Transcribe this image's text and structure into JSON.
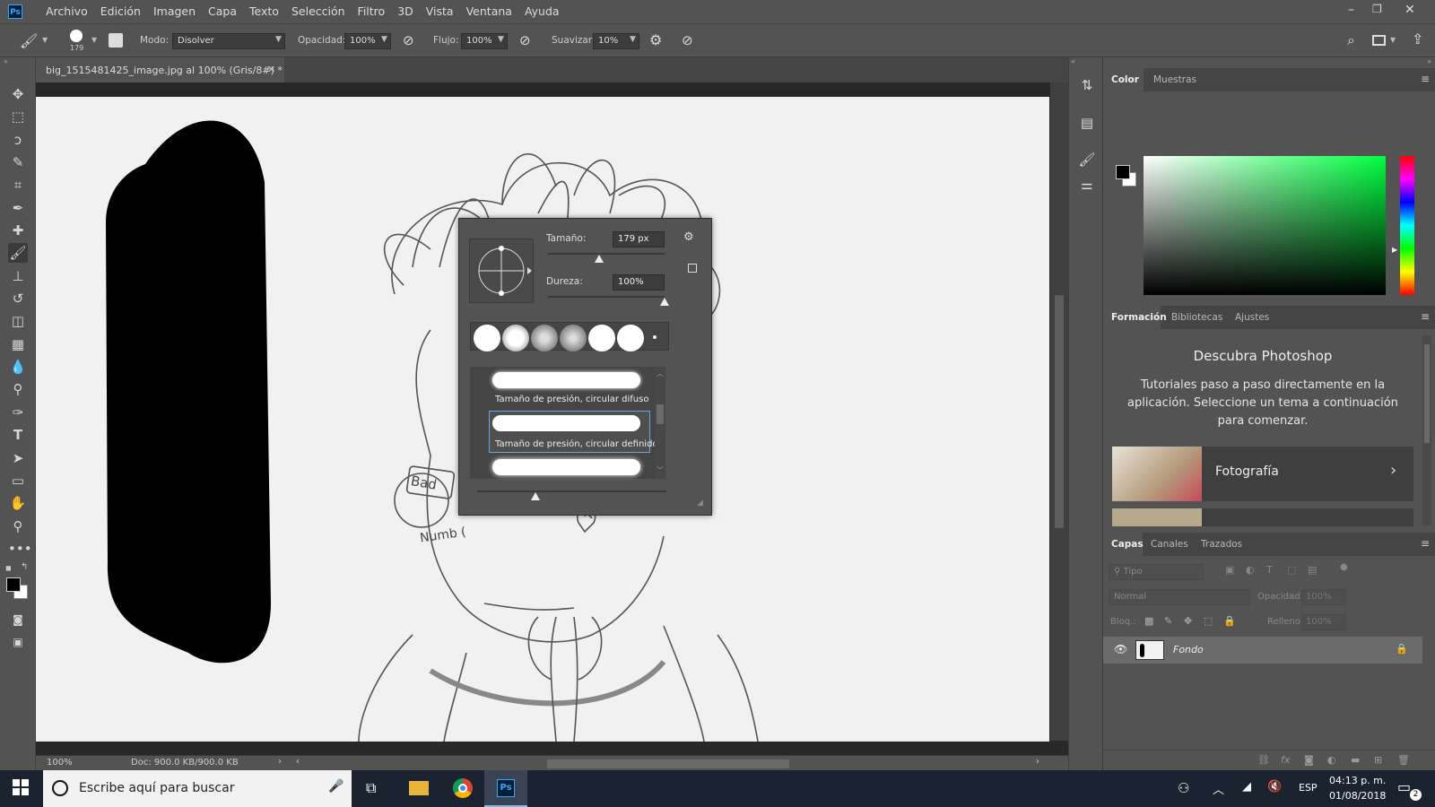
{
  "app": {
    "logo": "Ps"
  },
  "menu": [
    "Archivo",
    "Edición",
    "Imagen",
    "Capa",
    "Texto",
    "Selección",
    "Filtro",
    "3D",
    "Vista",
    "Ventana",
    "Ayuda"
  ],
  "options": {
    "brush_size": "179",
    "mode_label": "Modo:",
    "mode_value": "Disolver",
    "opacity_label": "Opacidad:",
    "opacity_value": "100%",
    "flow_label": "Flujo:",
    "flow_value": "100%",
    "smoothing_label": "Suavizar:",
    "smoothing_value": "10%"
  },
  "document": {
    "tab_title": "big_1515481425_image.jpg al 100% (Gris/8#) *",
    "zoom": "100%",
    "doc_info": "Doc: 900.0 KB/900.0 KB",
    "drawing_text": [
      "Bad",
      "Numb ("
    ]
  },
  "brush_popup": {
    "size_label": "Tamaño:",
    "size_value": "179 px",
    "size_fraction": 0.44,
    "hardness_label": "Dureza:",
    "hardness_value": "100%",
    "hardness_fraction": 1.0,
    "presets": [
      {
        "label": "Tamaño de presión, circular difuso",
        "selected": false
      },
      {
        "label": "Tamaño de presión, circular definido",
        "selected": true
      }
    ]
  },
  "color_panel": {
    "tabs": [
      "Color",
      "Muestras"
    ],
    "foreground": "#000000",
    "background": "#ffffff",
    "hue_color": "#00ff40"
  },
  "learn_panel": {
    "tabs": [
      "Formación",
      "Bibliotecas",
      "Ajustes"
    ],
    "title": "Descubra Photoshop",
    "description": "Tutoriales paso a paso directamente en la aplicación. Seleccione un tema a continuación para comenzar.",
    "card_label": "Fotografía"
  },
  "layers_panel": {
    "tabs": [
      "Capas",
      "Canales",
      "Trazados"
    ],
    "filter_placeholder": "Tipo",
    "blend_mode": "Normal",
    "opacity_label": "Opacidad:",
    "opacity_value": "100%",
    "lock_label": "Bloq.:",
    "fill_label": "Relleno:",
    "fill_value": "100%",
    "layers": [
      {
        "name": "Fondo",
        "visible": true,
        "locked": true
      }
    ]
  },
  "taskbar": {
    "search_placeholder": "Escribe aquí para buscar",
    "language": "ESP",
    "time": "04:13 p. m.",
    "date": "01/08/2018",
    "notifications": "2"
  }
}
